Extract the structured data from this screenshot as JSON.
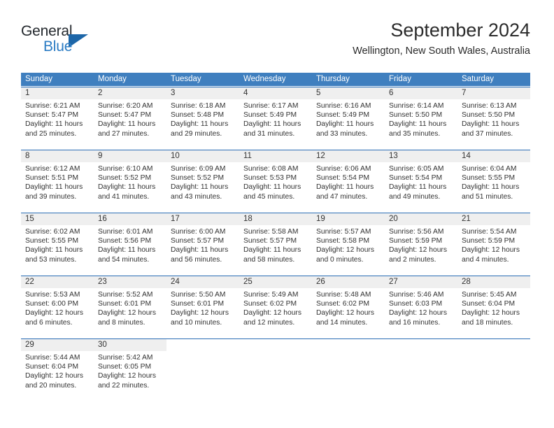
{
  "brand": {
    "word1": "General",
    "word2": "Blue",
    "triangle_color": "#1d66a8",
    "blue_color": "#2b7cc4"
  },
  "header": {
    "title": "September 2024",
    "subtitle": "Wellington, New South Wales, Australia"
  },
  "theme": {
    "header_bar": "#3f7fbf",
    "week_rule": "#2a6db5",
    "daynum_band": "#efefef",
    "text": "#333333"
  },
  "weekday_headers": [
    "Sunday",
    "Monday",
    "Tuesday",
    "Wednesday",
    "Thursday",
    "Friday",
    "Saturday"
  ],
  "weeks": [
    [
      {
        "day": "1",
        "lines": [
          "Sunrise: 6:21 AM",
          "Sunset: 5:47 PM",
          "Daylight: 11 hours",
          "and 25 minutes."
        ]
      },
      {
        "day": "2",
        "lines": [
          "Sunrise: 6:20 AM",
          "Sunset: 5:47 PM",
          "Daylight: 11 hours",
          "and 27 minutes."
        ]
      },
      {
        "day": "3",
        "lines": [
          "Sunrise: 6:18 AM",
          "Sunset: 5:48 PM",
          "Daylight: 11 hours",
          "and 29 minutes."
        ]
      },
      {
        "day": "4",
        "lines": [
          "Sunrise: 6:17 AM",
          "Sunset: 5:49 PM",
          "Daylight: 11 hours",
          "and 31 minutes."
        ]
      },
      {
        "day": "5",
        "lines": [
          "Sunrise: 6:16 AM",
          "Sunset: 5:49 PM",
          "Daylight: 11 hours",
          "and 33 minutes."
        ]
      },
      {
        "day": "6",
        "lines": [
          "Sunrise: 6:14 AM",
          "Sunset: 5:50 PM",
          "Daylight: 11 hours",
          "and 35 minutes."
        ]
      },
      {
        "day": "7",
        "lines": [
          "Sunrise: 6:13 AM",
          "Sunset: 5:50 PM",
          "Daylight: 11 hours",
          "and 37 minutes."
        ]
      }
    ],
    [
      {
        "day": "8",
        "lines": [
          "Sunrise: 6:12 AM",
          "Sunset: 5:51 PM",
          "Daylight: 11 hours",
          "and 39 minutes."
        ]
      },
      {
        "day": "9",
        "lines": [
          "Sunrise: 6:10 AM",
          "Sunset: 5:52 PM",
          "Daylight: 11 hours",
          "and 41 minutes."
        ]
      },
      {
        "day": "10",
        "lines": [
          "Sunrise: 6:09 AM",
          "Sunset: 5:52 PM",
          "Daylight: 11 hours",
          "and 43 minutes."
        ]
      },
      {
        "day": "11",
        "lines": [
          "Sunrise: 6:08 AM",
          "Sunset: 5:53 PM",
          "Daylight: 11 hours",
          "and 45 minutes."
        ]
      },
      {
        "day": "12",
        "lines": [
          "Sunrise: 6:06 AM",
          "Sunset: 5:54 PM",
          "Daylight: 11 hours",
          "and 47 minutes."
        ]
      },
      {
        "day": "13",
        "lines": [
          "Sunrise: 6:05 AM",
          "Sunset: 5:54 PM",
          "Daylight: 11 hours",
          "and 49 minutes."
        ]
      },
      {
        "day": "14",
        "lines": [
          "Sunrise: 6:04 AM",
          "Sunset: 5:55 PM",
          "Daylight: 11 hours",
          "and 51 minutes."
        ]
      }
    ],
    [
      {
        "day": "15",
        "lines": [
          "Sunrise: 6:02 AM",
          "Sunset: 5:55 PM",
          "Daylight: 11 hours",
          "and 53 minutes."
        ]
      },
      {
        "day": "16",
        "lines": [
          "Sunrise: 6:01 AM",
          "Sunset: 5:56 PM",
          "Daylight: 11 hours",
          "and 54 minutes."
        ]
      },
      {
        "day": "17",
        "lines": [
          "Sunrise: 6:00 AM",
          "Sunset: 5:57 PM",
          "Daylight: 11 hours",
          "and 56 minutes."
        ]
      },
      {
        "day": "18",
        "lines": [
          "Sunrise: 5:58 AM",
          "Sunset: 5:57 PM",
          "Daylight: 11 hours",
          "and 58 minutes."
        ]
      },
      {
        "day": "19",
        "lines": [
          "Sunrise: 5:57 AM",
          "Sunset: 5:58 PM",
          "Daylight: 12 hours",
          "and 0 minutes."
        ]
      },
      {
        "day": "20",
        "lines": [
          "Sunrise: 5:56 AM",
          "Sunset: 5:59 PM",
          "Daylight: 12 hours",
          "and 2 minutes."
        ]
      },
      {
        "day": "21",
        "lines": [
          "Sunrise: 5:54 AM",
          "Sunset: 5:59 PM",
          "Daylight: 12 hours",
          "and 4 minutes."
        ]
      }
    ],
    [
      {
        "day": "22",
        "lines": [
          "Sunrise: 5:53 AM",
          "Sunset: 6:00 PM",
          "Daylight: 12 hours",
          "and 6 minutes."
        ]
      },
      {
        "day": "23",
        "lines": [
          "Sunrise: 5:52 AM",
          "Sunset: 6:01 PM",
          "Daylight: 12 hours",
          "and 8 minutes."
        ]
      },
      {
        "day": "24",
        "lines": [
          "Sunrise: 5:50 AM",
          "Sunset: 6:01 PM",
          "Daylight: 12 hours",
          "and 10 minutes."
        ]
      },
      {
        "day": "25",
        "lines": [
          "Sunrise: 5:49 AM",
          "Sunset: 6:02 PM",
          "Daylight: 12 hours",
          "and 12 minutes."
        ]
      },
      {
        "day": "26",
        "lines": [
          "Sunrise: 5:48 AM",
          "Sunset: 6:02 PM",
          "Daylight: 12 hours",
          "and 14 minutes."
        ]
      },
      {
        "day": "27",
        "lines": [
          "Sunrise: 5:46 AM",
          "Sunset: 6:03 PM",
          "Daylight: 12 hours",
          "and 16 minutes."
        ]
      },
      {
        "day": "28",
        "lines": [
          "Sunrise: 5:45 AM",
          "Sunset: 6:04 PM",
          "Daylight: 12 hours",
          "and 18 minutes."
        ]
      }
    ],
    [
      {
        "day": "29",
        "lines": [
          "Sunrise: 5:44 AM",
          "Sunset: 6:04 PM",
          "Daylight: 12 hours",
          "and 20 minutes."
        ]
      },
      {
        "day": "30",
        "lines": [
          "Sunrise: 5:42 AM",
          "Sunset: 6:05 PM",
          "Daylight: 12 hours",
          "and 22 minutes."
        ]
      },
      {
        "day": "",
        "lines": []
      },
      {
        "day": "",
        "lines": []
      },
      {
        "day": "",
        "lines": []
      },
      {
        "day": "",
        "lines": []
      },
      {
        "day": "",
        "lines": []
      }
    ]
  ]
}
